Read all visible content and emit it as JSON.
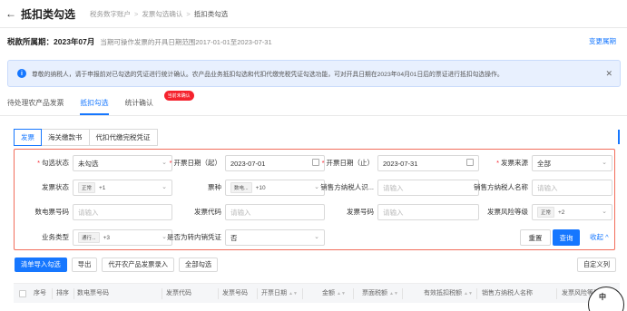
{
  "header": {
    "back_icon": "arrow-left-icon",
    "title": "抵扣类勾选",
    "breadcrumbs": [
      "税务数字账户",
      "发票勾选确认",
      "抵扣类勾选"
    ]
  },
  "period": {
    "label": "税款所属期：",
    "value": "2023年07月",
    "range_text": "当期可操作发票的开具日期范围2017-01-01至2023-07-31",
    "change_link": "变更属期"
  },
  "notice": {
    "icon": "info-icon",
    "text": "尊敬的纳税人，请于申报前对已勾选的凭证进行统计确认。农产品业务抵扣勾选和代扣代缴完税凭证勾选功能，可对开具日期在2023年04月01日后的票证进行抵扣勾选操作。",
    "close_icon": "close-icon"
  },
  "tabs": {
    "items": [
      "待处理农产品发票",
      "抵扣勾选",
      "统计确认"
    ],
    "active": "抵扣勾选",
    "badge": "当前未确认"
  },
  "subtabs": {
    "items": [
      "发票",
      "海关缴款书",
      "代扣代缴完税凭证"
    ],
    "active": "发票"
  },
  "filters": {
    "row1": {
      "check_status_label": "勾选状态",
      "check_status_value": "未勾选",
      "date_start_label": "开票日期（起）",
      "date_start_value": "2023-07-01",
      "date_end_label": "开票日期（止）",
      "date_end_value": "2023-07-31",
      "source_label": "发票来源",
      "source_value": "全部"
    },
    "row2": {
      "invoice_status_label": "发票状态",
      "invoice_status_chip": "正常",
      "invoice_status_more": "+1",
      "ticket_type_label": "票种",
      "ticket_type_chip": "数电...",
      "ticket_type_more": "+10",
      "seller_id_label": "销售方纳税人识...",
      "seller_id_placeholder": "请输入",
      "seller_name_label": "销售方纳税人名称",
      "seller_name_placeholder": "请输入"
    },
    "row3": {
      "digital_no_label": "数电票号码",
      "digital_no_placeholder": "请输入",
      "invoice_code_label": "发票代码",
      "invoice_code_placeholder": "请输入",
      "invoice_no_label": "发票号码",
      "invoice_no_placeholder": "请输入",
      "risk_level_label": "发票风险等级",
      "risk_level_chip": "正常",
      "risk_level_more": "+2"
    },
    "row4": {
      "biz_type_label": "业务类型",
      "biz_type_chip": "通行...",
      "biz_type_more": "+3",
      "transfer_label": "是否为转内销凭证",
      "transfer_value": "否",
      "reset": "重置",
      "query": "查询",
      "collapse": "收起"
    }
  },
  "actions": {
    "buttons": [
      "清单导入勾选",
      "导出",
      "代开农产品发票录入",
      "全部勾选"
    ],
    "custom_columns": "自定义列"
  },
  "table": {
    "columns": [
      "序号",
      "排序",
      "数电票号码",
      "发票代码",
      "发票号码",
      "开票日期",
      "金额",
      "票面税额",
      "有效抵扣税额",
      "销售方纳税人名称",
      "发票风险等级"
    ]
  },
  "mascot": {
    "text": "中"
  }
}
